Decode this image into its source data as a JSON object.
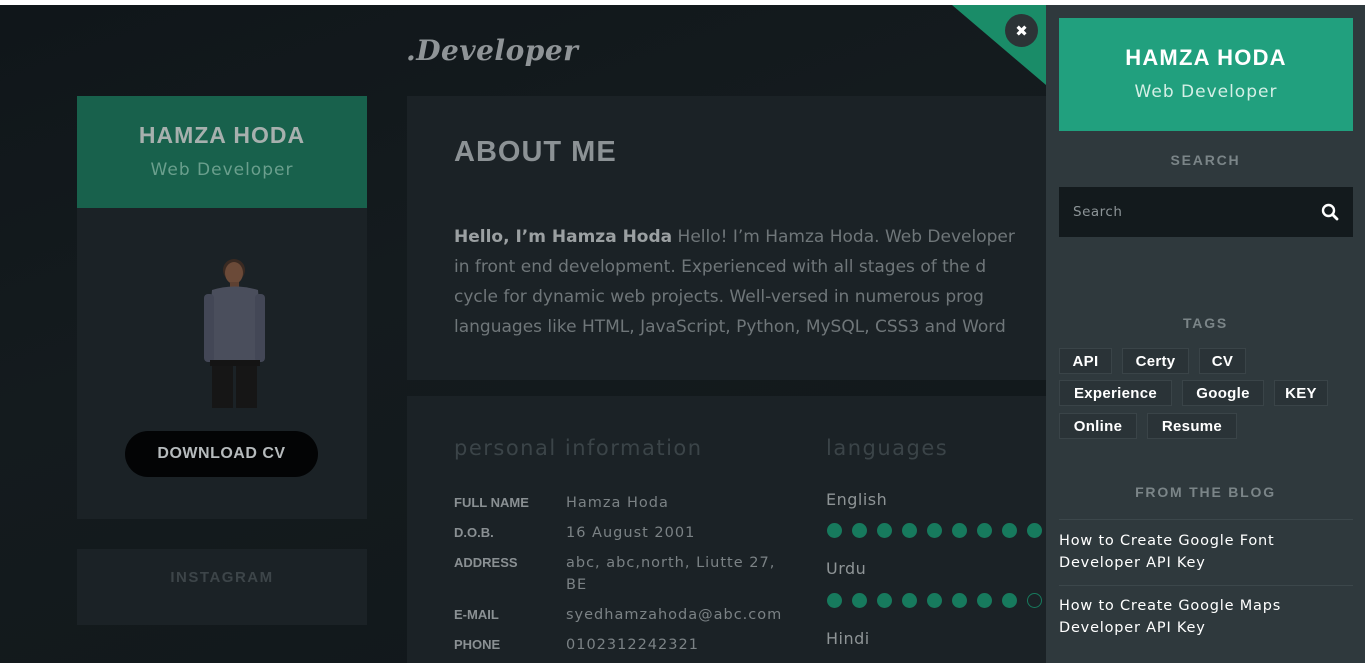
{
  "brand": ".Developer",
  "profile": {
    "name": "HAMZA HODA",
    "role": "Web Developer",
    "download_label": "DOWNLOAD CV"
  },
  "instagram": {
    "label": "INSTAGRAM"
  },
  "about": {
    "title": "ABOUT ME",
    "intro_bold": "Hello, I’m Hamza Hoda",
    "lines": [
      " Hello! I’m Hamza Hoda. Web Developer",
      "in front end development. Experienced with all stages of the d",
      "cycle for dynamic web projects. Well-versed in numerous prog",
      "languages like HTML, JavaScript, Python, MySQL, CSS3 and Word"
    ]
  },
  "personal": {
    "title": "personal information",
    "rows": [
      {
        "label": "FULL NAME",
        "value": "Hamza Hoda"
      },
      {
        "label": "D.O.B.",
        "value": "16 August 2001"
      },
      {
        "label": "ADDRESS",
        "value": "abc, abc,north, Liutte 27, BE"
      },
      {
        "label": "E-MAIL",
        "value": "syedhamzahoda@abc.com"
      },
      {
        "label": "PHONE",
        "value": "0102312242321"
      }
    ]
  },
  "languages": {
    "title": "languages",
    "items": [
      {
        "name": "English",
        "level": 9,
        "of": 9
      },
      {
        "name": "Urdu",
        "level": 8,
        "of": 9
      },
      {
        "name": "Hindi"
      }
    ]
  },
  "sidebar": {
    "name": "HAMZA HODA",
    "role": "Web Developer",
    "search_title": "SEARCH",
    "search_placeholder": "Search",
    "tags_title": "TAGS",
    "tags": [
      "API",
      "Certy",
      "CV",
      "Experience",
      "Google",
      "KEY",
      "Online",
      "Resume"
    ],
    "blog_title": "FROM THE BLOG",
    "blog_posts": [
      "How to Create Google Font Developer API Key",
      "How to Create Google Maps Developer API Key"
    ]
  },
  "colors": {
    "accent": "#21a07e",
    "dot": "#177a5d",
    "sidebar_bg": "#2f393d"
  },
  "icons": {
    "close": "close-icon",
    "search": "search-icon"
  }
}
